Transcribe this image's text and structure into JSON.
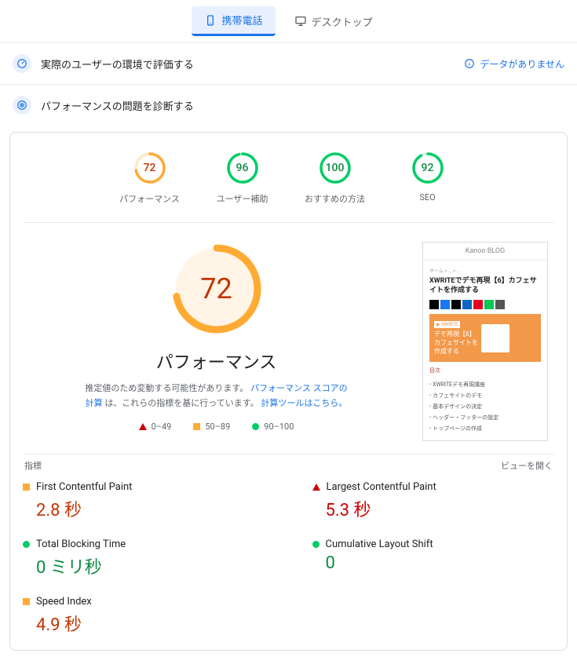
{
  "tabs": {
    "mobile": "携帯電話",
    "desktop": "デスクトップ"
  },
  "section_user": {
    "title": "実際のユーザーの環境で評価する",
    "no_data": "データがありません"
  },
  "section_diag": {
    "title": "パフォーマンスの問題を診断する"
  },
  "gauges": [
    {
      "score": 72,
      "label": "パフォーマンス",
      "color": "#fa3",
      "bg": "#ffe9c7"
    },
    {
      "score": 96,
      "label": "ユーザー補助",
      "color": "#0c6",
      "bg": "#d6f5e3"
    },
    {
      "score": 100,
      "label": "おすすめの方法",
      "color": "#0c6",
      "bg": "#d6f5e3"
    },
    {
      "score": 92,
      "label": "SEO",
      "color": "#0c6",
      "bg": "#d6f5e3"
    }
  ],
  "big": {
    "score": 72,
    "title": "パフォーマンス"
  },
  "desc": {
    "line1_a": "推定値のため変動する可能性があります。",
    "link1": "パフォーマンス スコアの計算",
    "line2_a": "は、これらの指標を基に行っています。",
    "link2": "計算ツールはこちら。"
  },
  "legend": {
    "r1": "0–49",
    "r2": "50–89",
    "r3": "90–100"
  },
  "preview": {
    "header": "Kanoo BLOG",
    "crumb": "ホーム > ... > ...",
    "title": "XWRITEでデモ再現【6】カフェサイトを作成する",
    "hero_line1": "デモ再現【6】",
    "hero_line2": "カフェサイトを",
    "hero_line3": "作成する",
    "meta": "目次",
    "items": [
      "XWRITEデモ再現講座",
      "カフェサイトのデモ",
      "基本デザインの決定",
      "ヘッダー・フッターの設定",
      "トップページの作成"
    ]
  },
  "metrics_header": {
    "label": "指標",
    "expand": "ビューを開く"
  },
  "metrics": [
    {
      "name": "First Contentful Paint",
      "value": "2.8 秒",
      "status": "orange"
    },
    {
      "name": "Largest Contentful Paint",
      "value": "5.3 秒",
      "status": "red"
    },
    {
      "name": "Total Blocking Time",
      "value": "0 ミリ秒",
      "status": "green"
    },
    {
      "name": "Cumulative Layout Shift",
      "value": "0",
      "status": "green"
    },
    {
      "name": "Speed Index",
      "value": "4.9 秒",
      "status": "orange"
    }
  ]
}
